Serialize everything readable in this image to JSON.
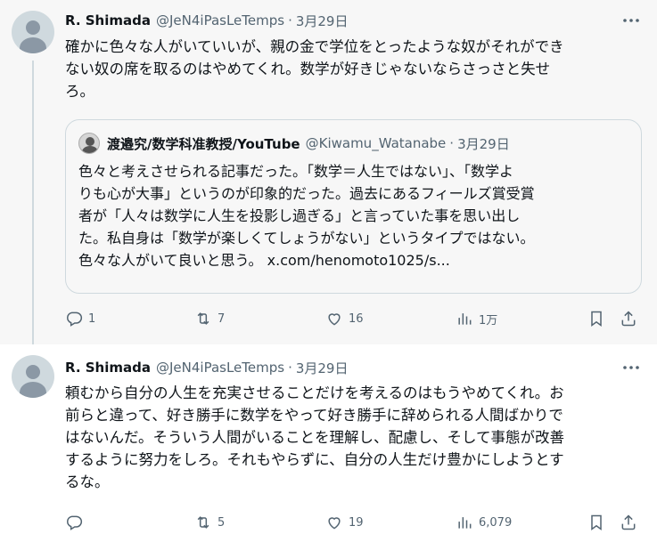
{
  "tweets": [
    {
      "name": "R. Shimada",
      "handle": "@JeN4iPasLeTemps",
      "date": "3月29日",
      "text_lines": [
        "確かに色々な人がいていいが、親の金で学位をとったような奴がそれができ",
        "ない奴の席を取るのはやめてくれ。数学が好きじゃないならさっさと失せ",
        "ろ。"
      ],
      "quote": {
        "name": "渡邉究/数学科准教授/YouTube",
        "handle": "@Kiwamu_Watanabe",
        "date": "3月29日",
        "text_lines": [
          "色々と考えさせられる記事だった。「数学＝人生ではない」、「数学よ",
          "りも心が大事」というのが印象的だった。過去にあるフィールズ賞受賞",
          "者が「人々は数学に人生を投影し過ぎる」と言っていた事を思い出し",
          "た。私自身は「数学が楽しくてしょうがない」というタイプではない。",
          "色々な人がいて良いと思う。"
        ],
        "link": "x.com/henomoto1025/s..."
      },
      "stats": {
        "replies": "1",
        "retweets": "7",
        "likes": "16",
        "views": "1万"
      }
    },
    {
      "name": "R. Shimada",
      "handle": "@JeN4iPasLeTemps",
      "date": "3月29日",
      "text_lines": [
        "頼むから自分の人生を充実させることだけを考えるのはもうやめてくれ。お",
        "前らと違って、好き勝手に数学をやって好き勝手に辞められる人間ばかりで",
        "はないんだ。そういう人間がいることを理解し、配慮し、そして事態が改善",
        "するように努力をしろ。それもやらずに、自分の人生だけ豊かにしようとす",
        "るな。"
      ],
      "stats": {
        "replies": "",
        "retweets": "5",
        "likes": "19",
        "views": "6,079"
      }
    }
  ],
  "icons": {
    "reply": "reply-icon",
    "retweet": "retweet-icon",
    "like": "heart-icon",
    "views": "views-chart-icon",
    "bookmark": "bookmark-icon",
    "share": "share-icon",
    "more": "more-icon"
  },
  "colors": {
    "muted": "#536471",
    "text": "#0f1419",
    "border": "#cfd9de",
    "highlight_bg": "#f7f7f7"
  }
}
